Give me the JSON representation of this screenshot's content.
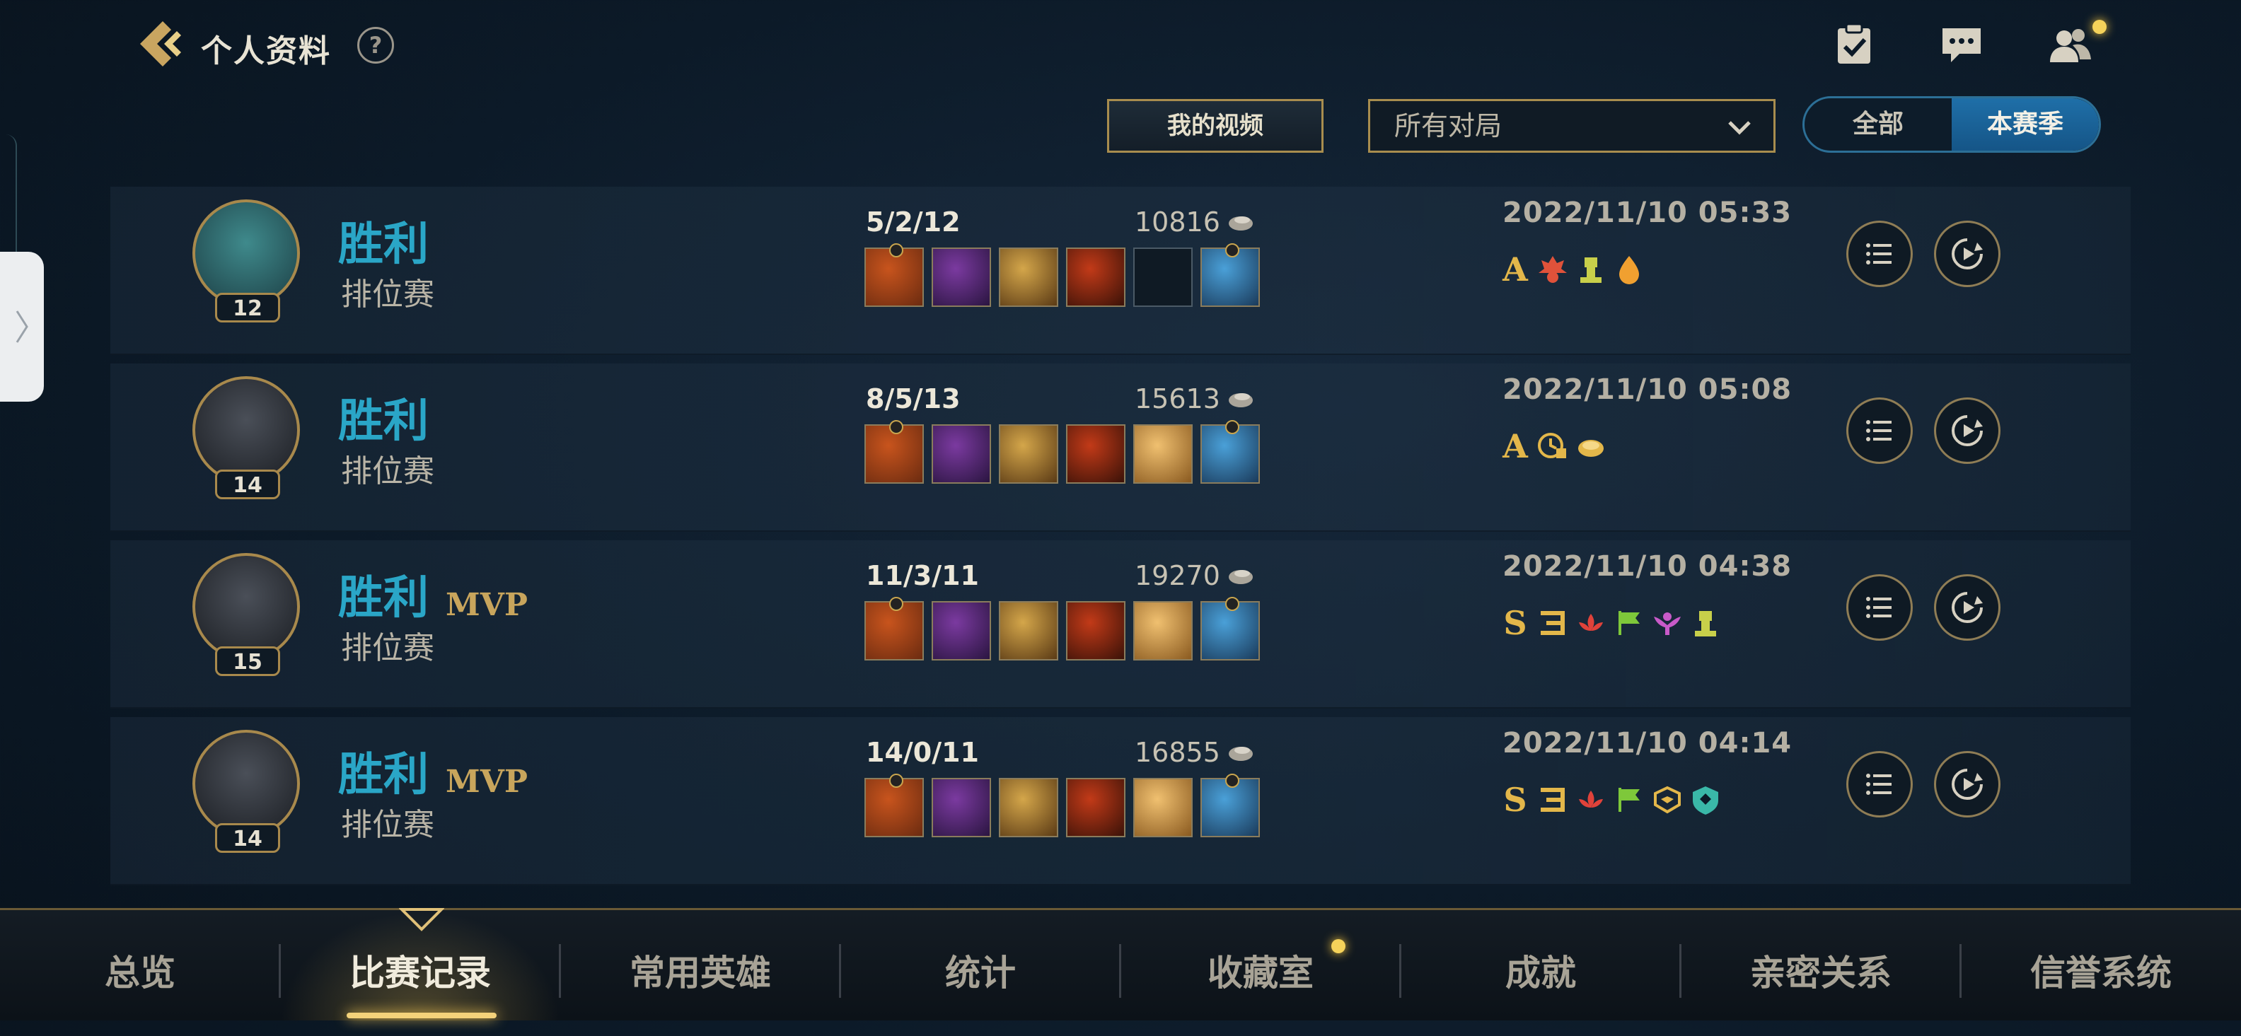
{
  "header": {
    "title": "个人资料",
    "help_label": "?"
  },
  "filters": {
    "my_video_label": "我的视频",
    "match_filter_value": "所有对局",
    "season_toggle": [
      "全部",
      "本赛季"
    ],
    "season_toggle_selected": "本赛季"
  },
  "edge": {
    "id_text": "781907"
  },
  "matches": [
    {
      "result": "胜利",
      "mvp": "",
      "mode": "排位赛",
      "level": "12",
      "kda": "5/2/12",
      "gold": "10816",
      "datetime": "2022/11/10 05:33",
      "grade": "A",
      "items": [
        "item-1",
        "item-2",
        "item-3",
        "item-4",
        "empty",
        "item-6"
      ],
      "badges": [
        "fire-crest-badge",
        "tower-badge",
        "flame-badge"
      ]
    },
    {
      "result": "胜利",
      "mvp": "",
      "mode": "排位赛",
      "level": "14",
      "kda": "8/5/13",
      "gold": "15613",
      "datetime": "2022/11/10 05:08",
      "grade": "A",
      "items": [
        "item-1",
        "item-2",
        "item-3",
        "item-4",
        "item-5",
        "item-6"
      ],
      "badges": [
        "clock-badge",
        "coin-badge"
      ]
    },
    {
      "result": "胜利",
      "mvp": "MVP",
      "mode": "排位赛",
      "level": "15",
      "kda": "11/3/11",
      "gold": "19270",
      "datetime": "2022/11/10 04:38",
      "grade": "S",
      "items": [
        "item-1",
        "item-2",
        "item-3",
        "item-4",
        "item-5",
        "item-6"
      ],
      "badges": [
        "triple-kill-badge",
        "lotus-badge",
        "flag-badge",
        "winged-badge",
        "tower-badge"
      ]
    },
    {
      "result": "胜利",
      "mvp": "MVP",
      "mode": "排位赛",
      "level": "14",
      "kda": "14/0/11",
      "gold": "16855",
      "datetime": "2022/11/10 04:14",
      "grade": "S",
      "items": [
        "item-1",
        "item-2",
        "item-3",
        "item-4",
        "item-5",
        "item-6"
      ],
      "badges": [
        "triple-kill-badge",
        "lotus-badge",
        "flag-badge",
        "ward-badge",
        "shield-badge"
      ]
    }
  ],
  "nav": {
    "tabs": [
      "总览",
      "比赛记录",
      "常用英雄",
      "统计",
      "收藏室",
      "成就",
      "亲密关系",
      "信誉系统"
    ],
    "active": "比赛记录"
  },
  "colors": {
    "victory": "#2aa6c7",
    "gold_accent": "#c8a55c",
    "active_toggle": "#1f6fa8"
  }
}
